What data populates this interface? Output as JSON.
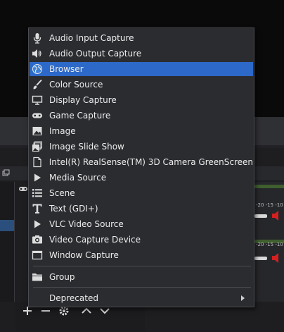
{
  "menu": {
    "items": [
      {
        "label": "Audio Input Capture",
        "icon": "microphone-icon"
      },
      {
        "label": "Audio Output Capture",
        "icon": "speaker-icon"
      },
      {
        "label": "Browser",
        "icon": "globe-icon",
        "highlighted": true
      },
      {
        "label": "Color Source",
        "icon": "paint-brush-icon"
      },
      {
        "label": "Display Capture",
        "icon": "monitor-icon"
      },
      {
        "label": "Game Capture",
        "icon": "gamepad-icon"
      },
      {
        "label": "Image",
        "icon": "image-icon"
      },
      {
        "label": "Image Slide Show",
        "icon": "slideshow-icon"
      },
      {
        "label": "Intel(R) RealSense(TM) 3D Camera GreenScreen",
        "icon": "blank-page-icon"
      },
      {
        "label": "Media Source",
        "icon": "play-icon"
      },
      {
        "label": "Scene",
        "icon": "list-icon"
      },
      {
        "label": "Text (GDI+)",
        "icon": "text-icon"
      },
      {
        "label": "VLC Video Source",
        "icon": "play-icon"
      },
      {
        "label": "Video Capture Device",
        "icon": "camera-icon"
      },
      {
        "label": "Window Capture",
        "icon": "window-icon"
      }
    ],
    "group_label": "Group",
    "deprecated_label": "Deprecated"
  },
  "mixer": {
    "ticks_top": "-20  -15  -10",
    "ticks_bottom": "-20  -15  -10"
  },
  "colors": {
    "menu_bg": "#2b2c30",
    "highlight": "#2d69c8",
    "mute_red": "#d42020"
  }
}
